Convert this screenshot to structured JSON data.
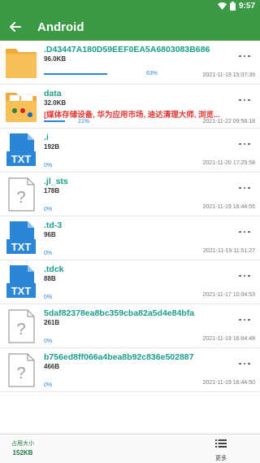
{
  "status": {
    "time": "9:57"
  },
  "appbar": {
    "title": "Android"
  },
  "files": [
    {
      "type": "folder",
      "name": ".D43447A180D59EEF0EA5A6803083B686",
      "size": "96.0KB",
      "desc": "",
      "progress_pct": 63,
      "progress_label": "63%",
      "date": "2021-11-19 15:07:39"
    },
    {
      "type": "folder-content",
      "name": "data",
      "size": "32.0KB",
      "desc": "[媒体存储设备, 华为应用市场, 迪达清理大师, 浏览...",
      "progress_pct": 21,
      "progress_label": "21%",
      "date": "2021-11-22 09:56:18"
    },
    {
      "type": "txt",
      "name": ".i",
      "size": "192B",
      "desc": "",
      "progress_pct": 0,
      "progress_label": "0%",
      "date": "2021-11-20 17:25:58"
    },
    {
      "type": "unknown",
      "name": ".jl_sts",
      "size": "178B",
      "desc": "",
      "progress_pct": 0,
      "progress_label": "0%",
      "date": "2021-11-19 16:44:55"
    },
    {
      "type": "txt",
      "name": ".td-3",
      "size": "96B",
      "desc": "",
      "progress_pct": 0,
      "progress_label": "0%",
      "date": "2021-11-19 11:51:27"
    },
    {
      "type": "txt",
      "name": ".tdck",
      "size": "88B",
      "desc": "",
      "progress_pct": 0,
      "progress_label": "0%",
      "date": "2021-11-17 10:04:53"
    },
    {
      "type": "unknown",
      "name": "5daf82378ea8bc359cba82a5d4e84bfa",
      "size": "261B",
      "desc": "",
      "progress_pct": 0,
      "progress_label": "0%",
      "date": "2021-11-19 16:04:48"
    },
    {
      "type": "unknown",
      "name": "b756ed8ff066a4bea8b92c836e502887",
      "size": "466B",
      "desc": "",
      "progress_pct": 0,
      "progress_label": "0%",
      "date": "2021-11-19 16:44:50"
    }
  ],
  "bottombar": {
    "usage_label": "占用大小",
    "usage_value": "152KB",
    "more_label": "更多"
  },
  "colors": {
    "accent": "#3c9a47",
    "name": "#1a9e8c",
    "progress": "#2b86d8",
    "desc": "#e53935"
  }
}
